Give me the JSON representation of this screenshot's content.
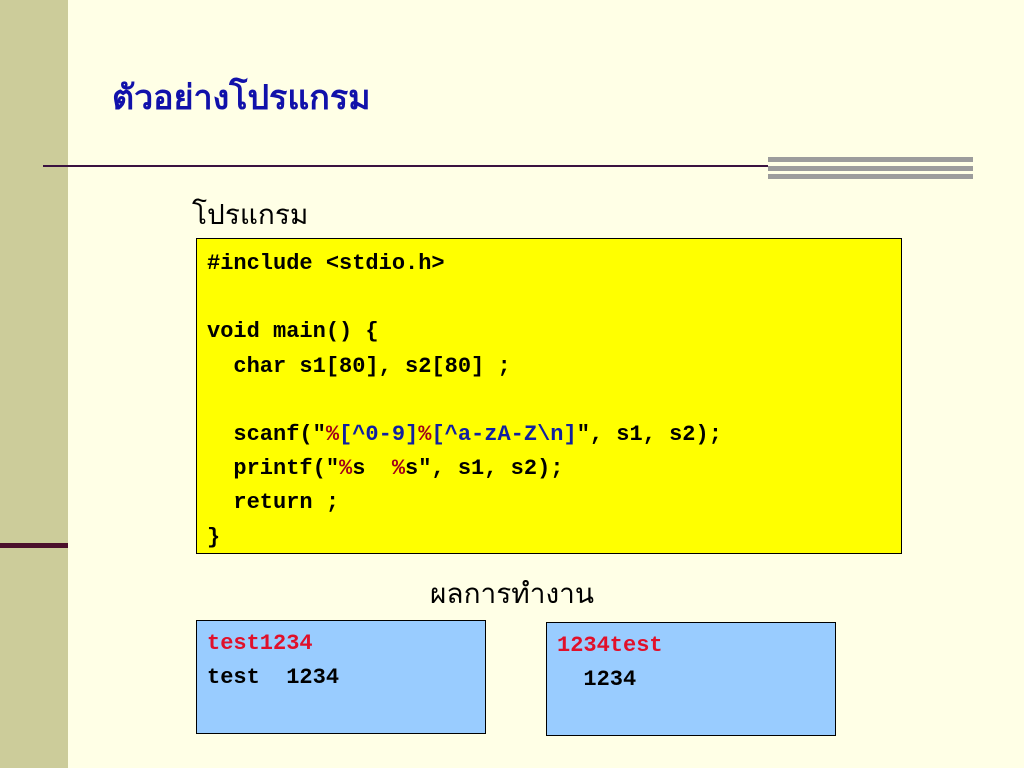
{
  "slide": {
    "title": "ตัวอย่างโปรแกรม",
    "program_label": "โปรแกรม",
    "result_label": "ผลการทำงาน"
  },
  "code": {
    "l1": "#include <stdio.h>",
    "l3": "void main() {",
    "l4": "  char s1[80], s2[80] ;",
    "l6a": "  scanf(\"",
    "l6b": "%",
    "l6c": "[^0-9]",
    "l6d": "%",
    "l6e": "[^a-zA-Z\\n]",
    "l6f": "\", s1, s2);",
    "l7a": "  printf(\"",
    "l7b": "%",
    "l7c": "s  ",
    "l7d": "%",
    "l7e": "s\", s1, s2);",
    "l8": "  return ;",
    "l9": "}"
  },
  "output1": {
    "input": "test1234",
    "output": "test  1234"
  },
  "output2": {
    "input": "1234test",
    "output": "  1234"
  },
  "colors": {
    "background": "#FFFFE6",
    "title": "#1111AA",
    "code_bg": "#FFFF00",
    "output_bg": "#99CCFF",
    "input_text": "#E0102A",
    "percent": "#A0001A",
    "format_spec": "#1020A0"
  }
}
